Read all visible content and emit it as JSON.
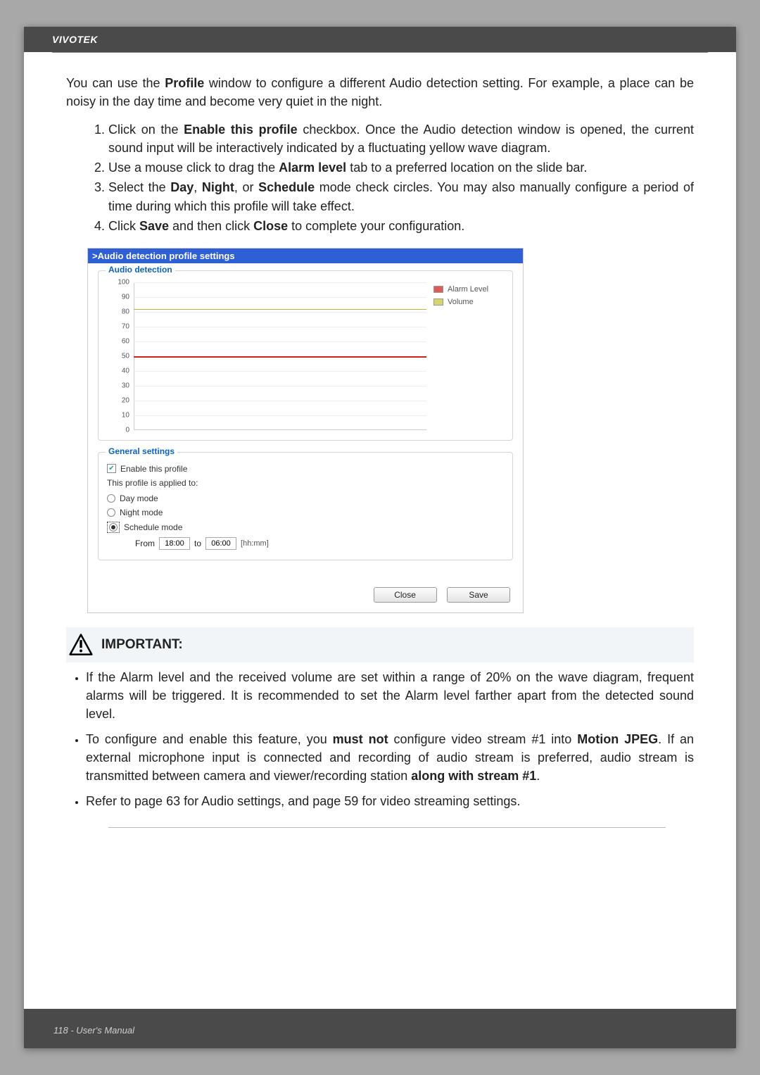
{
  "header": {
    "brand": "VIVOTEK"
  },
  "intro": {
    "p1_a": "You can use the ",
    "p1_b": "Profile",
    "p1_c": " window to configure a different Audio detection setting. For example, a place can be noisy in the day time and become very quiet in the night."
  },
  "steps": {
    "s1_a": "Click on the ",
    "s1_b": "Enable this profile",
    "s1_c": " checkbox. Once the Audio detection window is opened, the current sound input will be interactively indicated by a fluctuating yellow wave diagram.",
    "s2_a": "Use a mouse click to drag the ",
    "s2_b": "Alarm level",
    "s2_c": " tab to a preferred location on the slide bar.",
    "s3_a": "Select the ",
    "s3_b": "Day",
    "s3_c": ", ",
    "s3_d": "Night",
    "s3_e": ", or ",
    "s3_f": "Schedule",
    "s3_g": " mode check circles. You may also manually configure a period of time during which this profile will take effect.",
    "s4_a": "Click ",
    "s4_b": "Save",
    "s4_c": " and then click ",
    "s4_d": "Close",
    "s4_e": " to complete your configuration."
  },
  "screenshot": {
    "title": ">Audio detection profile settings",
    "audio_legend": "Audio detection",
    "legend_alarm": "Alarm Level",
    "legend_volume": "Volume",
    "general_legend": "General settings",
    "enable_label": "Enable this profile",
    "applied_label": "This profile is applied to:",
    "day_label": "Day mode",
    "night_label": "Night mode",
    "schedule_label": "Schedule mode",
    "from_label": "From",
    "to_label": "to",
    "from_value": "18:00",
    "to_value": "06:00",
    "hhmm": "[hh:mm]",
    "close_btn": "Close",
    "save_btn": "Save"
  },
  "chart_data": {
    "type": "line",
    "ylim": [
      0,
      100
    ],
    "y_ticks": [
      0,
      10,
      20,
      30,
      40,
      50,
      60,
      70,
      80,
      90,
      100
    ],
    "alarm_level": 50,
    "volume_level": 82,
    "series": [
      {
        "name": "Alarm Level",
        "color": "#d02020",
        "value": 50
      },
      {
        "name": "Volume",
        "color": "#b8b83a",
        "value": 82
      }
    ]
  },
  "important": {
    "title": "IMPORTANT:",
    "b1": "If the Alarm level and the received volume are set within a range of 20% on the wave diagram, frequent alarms will be triggered. It is recommended to set the Alarm level farther apart from the detected sound level.",
    "b2_a": "To configure and enable this feature, you ",
    "b2_b": "must not",
    "b2_c": " configure video stream #1 into ",
    "b2_d": "Motion JPEG",
    "b2_e": ". If an external microphone input is connected and recording of audio stream is preferred, audio stream is transmitted between camera and viewer/recording station ",
    "b2_f": "along with stream #1",
    "b2_g": ".",
    "b3": "Refer to page 63 for Audio settings, and page 59 for video streaming settings."
  },
  "footer": {
    "text": "118 - User's Manual"
  }
}
